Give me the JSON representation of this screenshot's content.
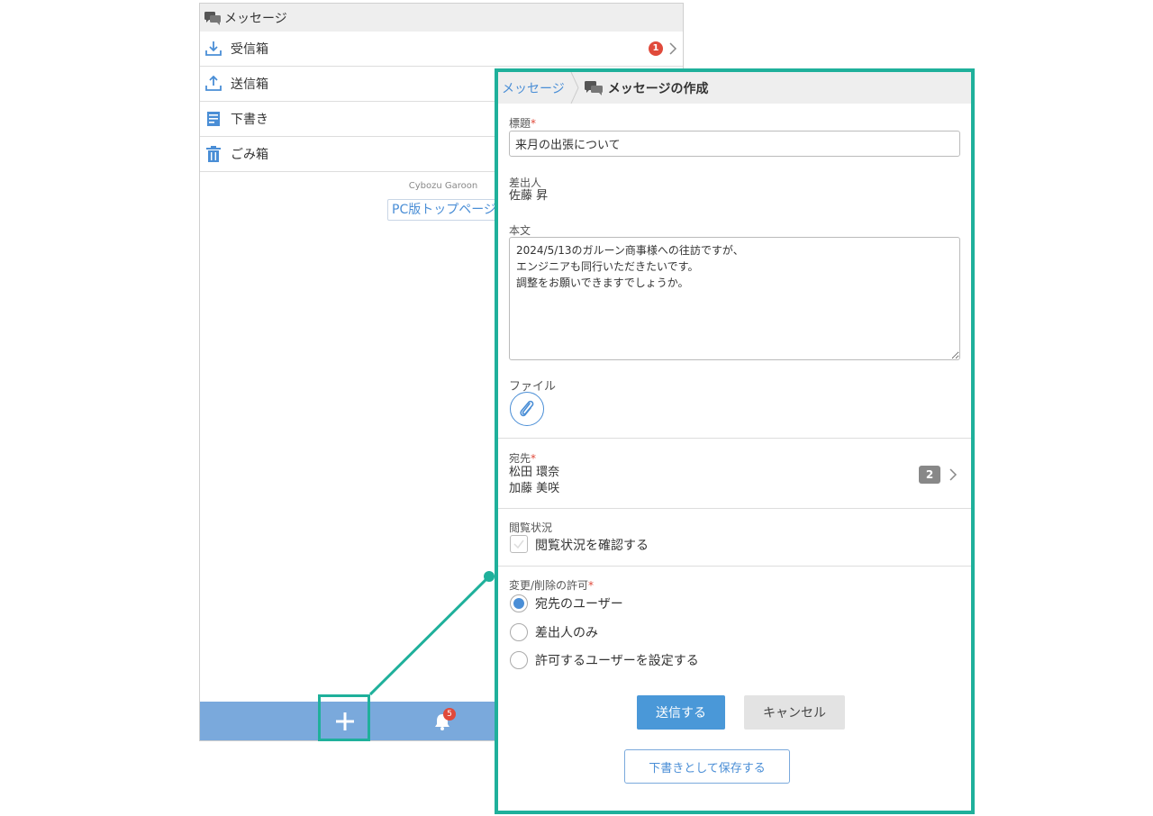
{
  "background_screen": {
    "header_title": "メッセージ",
    "folders": [
      {
        "label": "受信箱",
        "icon": "inbox-download-icon",
        "unread": "1"
      },
      {
        "label": "送信箱",
        "icon": "outbox-upload-icon"
      },
      {
        "label": "下書き",
        "icon": "draft-document-icon"
      },
      {
        "label": "ごみ箱",
        "icon": "trash-icon"
      }
    ],
    "product_name": "Cybozu Garoon",
    "pc_top_link": "PC版トップページ",
    "footer": {
      "new_button_icon": "plus-icon",
      "notification_count": "5"
    }
  },
  "compose": {
    "breadcrumb_link": "メッセージ",
    "breadcrumb_title": "メッセージの作成",
    "subject_label": "標題",
    "subject_value": "来月の出張について",
    "sender_label": "差出人",
    "sender_value": "佐藤 昇",
    "body_label": "本文",
    "body_value": "2024/5/13のガルーン商事様への往訪ですが、\nエンジニアも同行いただきたいです。\n調整をお願いできますでしょうか。",
    "file_label": "ファイル",
    "to_label": "宛先",
    "to_recipients": [
      "松田 環奈",
      "加藤 美咲"
    ],
    "to_count": "2",
    "read_status_label": "閲覧状況",
    "read_status_option": "閲覧状況を確認する",
    "permission_label": "変更/削除の許可",
    "permission_options": [
      "宛先のユーザー",
      "差出人のみ",
      "許可するユーザーを設定する"
    ],
    "permission_selected": "宛先のユーザー",
    "send_label": "送信する",
    "cancel_label": "キャンセル",
    "draft_label": "下書きとして保存する",
    "required_mark": "*"
  },
  "colors": {
    "highlight": "#1fb09b",
    "accent_blue": "#4a98d8",
    "footer_blue": "#7aa9dc",
    "badge_red": "#e04a3b"
  }
}
